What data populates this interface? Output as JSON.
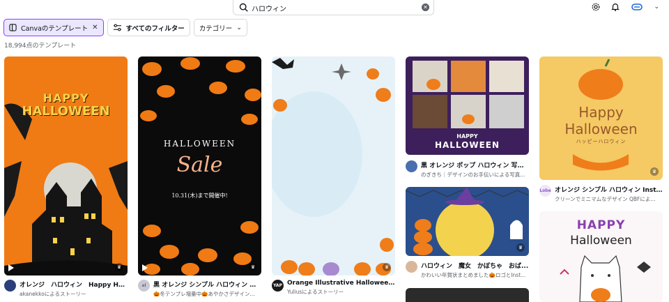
{
  "search": {
    "value": "ハロウィン",
    "clear_icon": "close-circle-icon"
  },
  "header": {
    "icons": [
      "settings-icon",
      "bell-icon",
      "brand-logo",
      "chevron-down-icon"
    ]
  },
  "filters": {
    "canva_chip": "Canvaのテンプレート",
    "all_filters": "すべてのフィルター",
    "category": "カテゴリー"
  },
  "result_count": "18,994点のテンプレート",
  "colors": {
    "accent": "#8b3dff",
    "chip_active_bg": "#ebe7ff",
    "orange": "#f07a14"
  },
  "cards": [
    {
      "title": "オレンジ　ハロウィン　Happy Hall...",
      "author": "akanekkoによるストーリー",
      "overlay_text_1": "HAPPY",
      "overlay_text_2": "HALLOWEEN",
      "avatar_text": ""
    },
    {
      "title": "黒 オレンジ シンプル ハロウィン パ...",
      "author": "🎃冬テンプレ増量中🎃あやかさデザイン...",
      "overlay_text_1": "HALLOWEEN",
      "overlay_text_2": "Sale",
      "overlay_text_3": "10.31(木)まで開催中!",
      "avatar_text": "al"
    },
    {
      "title": "Orange Illustrative Halloween Bac...",
      "author": "Yuliusによるストーリー",
      "avatar_text": "YAP"
    },
    {
      "title": "黒 オレンジ ポップ ハロウィン 写真...",
      "author": "のぎきち｜デザインのお手伝いによる写真...",
      "overlay_text_1": "HAPPY",
      "overlay_text_2": "HALLOWEEN",
      "avatar_text": ""
    },
    {
      "title": "ハロウィン　魔女　かぼちゃ　おば...",
      "author": "かわいい年賀状まとめました🎃ロゴとInst...",
      "avatar_text": ""
    },
    {
      "title": "オレンジ シンプル ハロウィン Instag...",
      "author": "クリーンでミニマムなデザイン QBFによ...",
      "overlay_text_1": "Happy",
      "overlay_text_2": "Halloween",
      "overlay_text_3": "ハッピーハロウィン",
      "avatar_text": "Lobe"
    },
    {
      "overlay_text_1": "HAPPY",
      "overlay_text_2": "Halloween"
    }
  ]
}
